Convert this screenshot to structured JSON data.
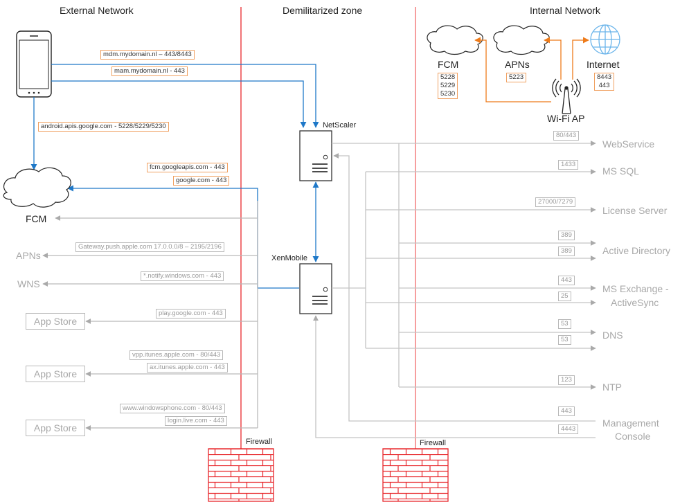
{
  "zones": {
    "external": "External Network",
    "dmz": "Demilitarized zone",
    "internal": "Internal Network"
  },
  "devices": {
    "netscaler": "NetScaler",
    "xenmobile": "XenMobile",
    "firewall_left": "Firewall",
    "firewall_right": "Firewall",
    "wifi_ap": "Wi-Fi AP"
  },
  "external": {
    "phone_links": [
      {
        "label": "mdm.mydomain.nl – 443/8443"
      },
      {
        "label": "mam.mydomain.nl - 443"
      },
      {
        "label": "android.apis.google.com - 5228/5229/5230"
      }
    ],
    "fcm_cloud_label": "FCM",
    "fcm_links": [
      {
        "label": "fcm.googleapis.com - 443"
      },
      {
        "label": "google.com - 443"
      }
    ],
    "targets": [
      {
        "name": "APNs",
        "ports": [
          "Gateway.push.apple.com 17.0.0.0/8 – 2195/2196"
        ]
      },
      {
        "name": "WNS",
        "ports": [
          "*.notify.windows.com - 443"
        ]
      },
      {
        "name": "App Store",
        "ports": [
          "play.google.com - 443"
        ]
      },
      {
        "name": "App Store",
        "ports": [
          "vpp.itunes.apple.com - 80/443",
          "ax.itunes.apple.com - 443"
        ]
      },
      {
        "name": "App Store",
        "ports": [
          "www.windowsphone.com - 80/443",
          "login.live.com - 443"
        ]
      }
    ]
  },
  "internal_wifi": {
    "fcm": {
      "name": "FCM",
      "ports": [
        "5228",
        "5229",
        "5230"
      ]
    },
    "apns": {
      "name": "APNs",
      "ports": [
        "5223"
      ]
    },
    "internet": {
      "name": "Internet",
      "ports": [
        "8443",
        "443"
      ]
    }
  },
  "internal_services": [
    {
      "name": "WebService",
      "ports": [
        "80/443"
      ]
    },
    {
      "name": "MS SQL",
      "ports": [
        "1433"
      ]
    },
    {
      "name": "License Server",
      "ports": [
        "27000/7279"
      ]
    },
    {
      "name": "Active Directory",
      "ports": [
        "389",
        "389"
      ]
    },
    {
      "name": "MS Exchange - ActiveSync",
      "name_line1": "MS Exchange -",
      "name_line2": "ActiveSync",
      "ports": [
        "443",
        "25"
      ]
    },
    {
      "name": "DNS",
      "ports": [
        "53",
        "53"
      ]
    },
    {
      "name": "NTP",
      "ports": [
        "123"
      ]
    },
    {
      "name": "Management Console",
      "name_line1": "Management",
      "name_line2": "Console",
      "ports": [
        "443",
        "4443"
      ]
    }
  ],
  "colors": {
    "firewall": "#e8262b",
    "blue_link": "#1e78c8",
    "orange_link": "#ee7b1a",
    "gray_link": "#b9b9b9",
    "orange_tag_border": "#f0a060"
  }
}
